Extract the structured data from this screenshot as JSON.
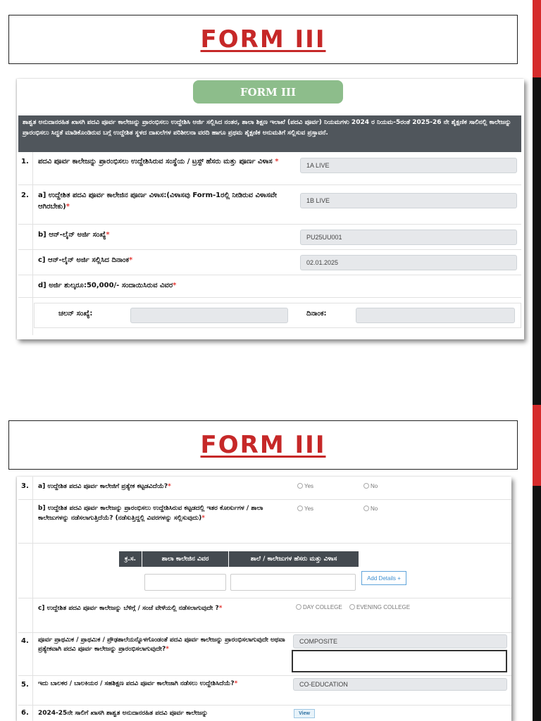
{
  "page_title": "FORM III",
  "shot1": {
    "pill": "FORM III",
    "note": "ಶಾಶ್ವತ ಅನುದಾನರಹಿತ ಖಾಸಗಿ ಪದವಿ ಪೂರ್ವ ಕಾಲೇಜನ್ನು ಪ್ರಾರಂಭಿಸಲು ಉದ್ದೇಶಿಸಿ ಅರ್ಜಿ ಸಲ್ಲಿಸಿದ ನಂತರ, ಶಾಲಾ ಶಿಕ್ಷಣ ಇಲಾಖೆ (ಪದವಿ ಪೂರ್ವ) ನಿಯಮಗಳು 2024 ರ ನಿಯಮ-5ರಂತೆ 2025-26 ನೇ ಶೈಕ್ಷಣಿಕ ಸಾಲಿನಲ್ಲಿ ಕಾಲೇಜನ್ನು ಪ್ರಾರಂಭಿಸಲು ಸಿದ್ಧತೆ ಮಾಡಿಕೊಂಡಿರುವ ಬಗ್ಗೆ ಉದ್ದೇಶಿತ ಸ್ಥಳದ ದಾಖಲೆಗಳ ಪರಿಶೀಲನಾ ವರದಿ ಹಾಗೂ ಪ್ರಥಮ ಶೈಕ್ಷಣಿಕ ಅನುಮತಿಗೆ ಸಲ್ಲಿಸುವ ಪ್ರಸ್ತಾವನೆ.",
    "rows": [
      {
        "num": "1.",
        "text": "ಪದವಿ ಪೂರ್ವ ಕಾಲೇಜನ್ನು ಪ್ರಾರಂಭಿಸಲು ಉದ್ದೇಶಿಸಿರುವ ಸಂಸ್ಥೆಯ / ಟ್ರಸ್ಟ್ ಹೆಸರು ಮತ್ತು ಪೂರ್ಣ ವಿಳಾಸ",
        "value": "1A LIVE"
      },
      {
        "num": "2.",
        "text": "a] ಉದ್ದೇಶಿತ ಪದವಿ ಪೂರ್ವ ಕಾಲೇಜಿನ ಪೂರ್ಣ ವಿಳಾಸ:(ವಿಳಾಸವು Form-1ರಲ್ಲಿ ನೀಡಿರುವ ವಿಳಾಸವೇ ಆಗಿರಬೇಕು)",
        "value": "1B LIVE"
      },
      {
        "num": "",
        "text": "b] ಆನ್-ಲೈನ್ ಅರ್ಜಿ ಸಂಖ್ಯೆ",
        "value": "PU25UU001"
      },
      {
        "num": "",
        "text": "c] ಆನ್-ಲೈನ್ ಅರ್ಜಿ ಸಲ್ಲಿಸಿದ ದಿನಾಂಕ",
        "value": "02.01.2025"
      },
      {
        "num": "",
        "text": "d] ಅರ್ಜಿ ಶುಲ್ಕರೂ:50,000/- ಸಂದಾಯಿಸಿರುವ ವಿವರ",
        "value": ""
      }
    ],
    "challan_label": "ಚಲನ್ ಸಂಖ್ಯೆ:",
    "date_label": "ದಿನಾಂಕ:"
  },
  "shot2": {
    "rows": [
      {
        "num": "3.",
        "text": "a] ಉದ್ದೇಶಿತ ಪದವಿ ಪೂರ್ವ ಕಾಲೇಜಿಗೆ ಪ್ರತ್ಯೇಕ ಕಟ್ಟಡವಿದೆಯೆ?",
        "opt1": "Yes",
        "opt2": "No"
      },
      {
        "num": "",
        "text": "b] ಉದ್ದೇಶಿತ ಪದವಿ ಪೂರ್ವ ಕಾಲೇಜನ್ನು ಪ್ರಾರಂಭಿಸಲು ಉದ್ದೇಶಿಸಿರುವ ಕಟ್ಟಡದಲ್ಲಿ ಇತರ ಕೋರ್ಸುಗಳ / ಶಾಲಾ ಕಾಲೇಜುಗಳನ್ನು ನಡೆಸಲಾಗುತ್ತಿದೆಯೆ? (ನಡೆಸುತ್ತಿದ್ದಲ್ಲಿ ವಿವರಗಳನ್ನು ಸಲ್ಲಿಸುವುದು)",
        "opt1": "Yes",
        "opt2": "No"
      }
    ],
    "table_headers": [
      "ಕ್ರ.ಸ.",
      "ಶಾಲಾ ಕಾಲೇಜಿನ ವಿವರ",
      "ಶಾಲೆ / ಕಾಲೇಜುಗಳ ಹೆಸರು ಮತ್ತು ವಿಳಾಸ"
    ],
    "add_details": "Add Details +",
    "row_c": {
      "text": "c] ಉದ್ದೇಶಿತ ಪದವಿ ಪೂರ್ವ ಕಾಲೇಜನ್ನು ಬೆಳಿಗ್ಗೆ / ಸಂಜೆ ವೇಳೆಯಲ್ಲಿ ನಡೆಸಲಾಗುವುದೇ ?",
      "opt1": "DAY COLLEGE",
      "opt2": "EVENING COLLEGE"
    },
    "row4": {
      "num": "4.",
      "text": "ಪೂರ್ವ ಪ್ರಾಥಮಿಕ / ಪ್ರಾಥಮಿಕ / ಪ್ರೌಢಶಾಲೆಯನ್ನೊಳಗೊಂಡಂತೆ ಪದವಿ ಪೂರ್ವ ಕಾಲೇಜನ್ನು ಪ್ರಾರಂಭಿಸಲಾಗುವುದೇ ಅಥವಾ ಪ್ರತ್ಯೇಕವಾಗಿ ಪದವಿ ಪೂರ್ವ ಕಾಲೇಜನ್ನು ಪ್ರಾರಂಭಿಸಲಾಗುವುದೇ?",
      "value": "COMPOSITE"
    },
    "row5": {
      "num": "5.",
      "text": "ಇದು ಬಾಲಕರ / ಬಾಲಕಿಯರ / ಸಹಶಿಕ್ಷಣ ಪದವಿ ಪೂರ್ವ ಕಾಲೇಜಾಗಿ ನಡೆಸಲು ಉದ್ದೇಶಿಸಿದೆಯೆ?",
      "value": "CO-EDUCATION"
    },
    "row6": {
      "num": "6.",
      "text": "2024-25ನೇ ಸಾಲಿಗೆ ಖಾಸಗಿ ಶಾಶ್ವತ ಅನುದಾನರಹಿತ ಪದವಿ ಪೂರ್ವ ಕಾಲೇಜನ್ನು",
      "view": "View"
    }
  }
}
